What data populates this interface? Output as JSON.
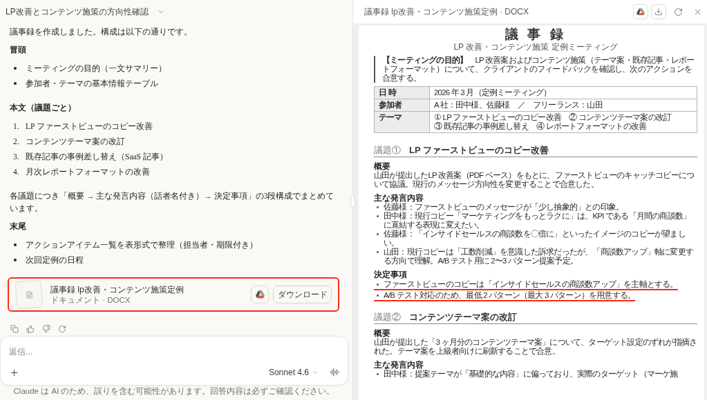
{
  "chat": {
    "title": "LP改善とコンテンツ施策の方向性確認",
    "blocks": [
      {
        "kind": "paragraph",
        "text": "議事録を作成しました。構成は以下の通りです。"
      },
      {
        "kind": "heading",
        "text": "冒頭"
      },
      {
        "kind": "bullets",
        "items": [
          "ミーティングの目的（一文サマリー）",
          "参加者・テーマの基本情報テーブル"
        ]
      },
      {
        "kind": "heading",
        "text": "本文（議題ごと）"
      },
      {
        "kind": "numbered",
        "items": [
          {
            "marker": "1.",
            "text": "LP ファーストビューのコピー改善"
          },
          {
            "marker": "2.",
            "text": "コンテンツテーマ案の改訂"
          },
          {
            "marker": "3.",
            "text": "既存記事の事例差し替え（SaaS 記事）"
          },
          {
            "marker": "4.",
            "text": "月次レポートフォーマットの改善"
          }
        ]
      },
      {
        "kind": "paragraph",
        "text": "各議題につき「概要 → 主な発言内容（話者名付き）→ 決定事項」の3段構成でまとめています。"
      },
      {
        "kind": "heading",
        "text": "末尾"
      },
      {
        "kind": "bullets",
        "items": [
          "アクションアイテム一覧を表形式で整理（担当者・期限付き）",
          "次回定例の日程"
        ]
      }
    ],
    "file_card": {
      "title": "議事録 lp改善・コンテンツ施策定例",
      "subtitle": "ドキュメント · DOCX",
      "download_label": "ダウンロード",
      "highlighted": true
    },
    "composer": {
      "placeholder": "返信...",
      "model": "Sonnet 4.6"
    },
    "disclaimer": "Claude は AI のため、誤りを含む可能性があります。回答内容は必ずご確認ください。"
  },
  "preview": {
    "title": "議事録 lp改善・コンテンツ施策定例 · DOCX",
    "document": {
      "title": "議 事 録",
      "subtitle": "LP 改善・コンテンツ施策 定例ミーティング",
      "purpose": "**【ミーティングの目的】**　LP 改善案およびコンテンツ施策（テーマ案・既存記事・レポートフォーマット）について、クライアントのフィードバックを確認し、次のアクションを合意する。",
      "info_table": [
        {
          "label": "日 時",
          "value": "2026 年 3 月（定例ミーティング）"
        },
        {
          "label": "参加者",
          "value": "A 社：田中様、佐藤様　／　フリーランス：山田"
        },
        {
          "label": "テーマ",
          "value": "① LP ファーストビューのコピー改善　② コンテンツテーマ案の改訂\n③ 既存記事の事例差し替え　④ レポートフォーマットの改善"
        }
      ],
      "agenda": [
        {
          "number": "議題①",
          "title": "LP ファーストビューのコピー改善",
          "sections": [
            {
              "heading": "概要",
              "kind": "paragraph",
              "text": "山田が提出したLP 改善案（PDF ベース）をもとに、ファーストビューのキャッチコピーについて協議。現行のメッセージ方向性を変更することで合意した。"
            },
            {
              "heading": "主な発言内容",
              "kind": "bullets",
              "items": [
                {
                  "text": "佐藤様：ファーストビューのメッセージが「少し抽象的」との印象。",
                  "underlined": false
                },
                {
                  "text": "田中様：現行コピー「マーケティングをもっとラクに」は、KPI である「月間の商談数」に直結する表現に変えたい。",
                  "underlined": false
                },
                {
                  "text": "佐藤様：「インサイドセールスの商談数を〇倍に」といったイメージのコピーが望ましい。",
                  "underlined": false
                },
                {
                  "text": "山田：現行コピーは「工数削減」を意識した訴求だったが、「商談数アップ」軸に変更する方向で理解。A/B テスト用に 2〜3 パターン提案予定。",
                  "underlined": false
                }
              ]
            },
            {
              "heading": "決定事項",
              "kind": "bullets",
              "items": [
                {
                  "text": "ファーストビューのコピーは「インサイドセールスの商談数アップ」を主軸とする。",
                  "underlined": true
                },
                {
                  "text": "A/B テスト対応のため、最低 2 パターン（最大 3 パターン）を用意する。",
                  "underlined": true
                }
              ]
            }
          ]
        },
        {
          "number": "議題②",
          "title": "コンテンツテーマ案の改訂",
          "sections": [
            {
              "heading": "概要",
              "kind": "paragraph",
              "text": "山田が提出した「3 ヶ月分のコンテンツテーマ案」について、ターゲット設定のずれが指摘された。テーマ案を上級者向けに刷新することで合意。"
            },
            {
              "heading": "主な発言内容",
              "kind": "bullets",
              "items": [
                {
                  "text": "田中様：提案テーマが「基礎的な内容」に偏っており、実際のターゲット（マーケ施",
                  "underlined": false
                }
              ]
            }
          ]
        }
      ]
    }
  }
}
